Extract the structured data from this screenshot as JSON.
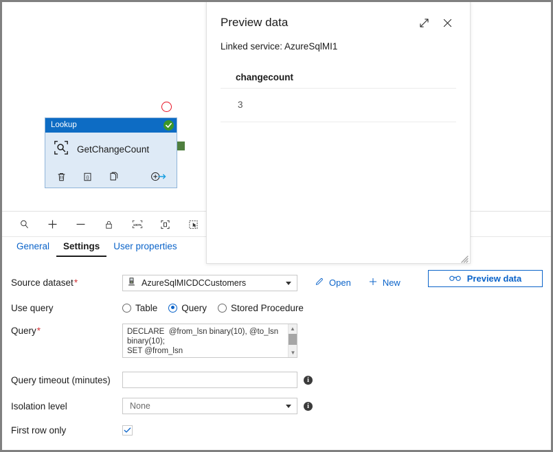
{
  "canvas": {
    "node": {
      "type_label": "Lookup",
      "name": "GetChangeCount",
      "status_icon": "check-icon",
      "actions": [
        "delete-icon",
        "code-icon",
        "clone-icon",
        "add-output-icon"
      ]
    },
    "toolbar": [
      {
        "name": "zoom-search-icon",
        "glyph": "search"
      },
      {
        "name": "zoom-in-icon",
        "glyph": "plus"
      },
      {
        "name": "zoom-out-icon",
        "glyph": "minus"
      },
      {
        "name": "lock-icon",
        "glyph": "lock"
      },
      {
        "name": "zoom-100-icon",
        "glyph": "100%"
      },
      {
        "name": "fit-to-screen-icon",
        "glyph": "fit"
      },
      {
        "name": "auto-align-icon",
        "glyph": "select"
      }
    ]
  },
  "tabs": [
    {
      "label": "General",
      "active": false
    },
    {
      "label": "Settings",
      "active": true
    },
    {
      "label": "User properties",
      "active": false
    }
  ],
  "form": {
    "source_dataset": {
      "label": "Source dataset",
      "required": "*",
      "value": "AzureSqlMICDCCustomers",
      "open_label": "Open",
      "new_label": "New",
      "preview_label": "Preview data"
    },
    "use_query": {
      "label": "Use query",
      "options": [
        {
          "label": "Table",
          "selected": false
        },
        {
          "label": "Query",
          "selected": true
        },
        {
          "label": "Stored Procedure",
          "selected": false
        }
      ]
    },
    "query": {
      "label": "Query",
      "required": "*",
      "value": "DECLARE  @from_lsn binary(10), @to_lsn\nbinary(10);\nSET @from_lsn"
    },
    "query_timeout": {
      "label": "Query timeout (minutes)",
      "value": "",
      "placeholder": ""
    },
    "isolation_level": {
      "label": "Isolation level",
      "value": "None"
    },
    "first_row_only": {
      "label": "First row only",
      "checked": true
    }
  },
  "preview_panel": {
    "title": "Preview data",
    "linked_service": "Linked service: AzureSqlMI1",
    "table": {
      "columns": [
        "changecount"
      ],
      "rows": [
        [
          "3"
        ]
      ]
    },
    "expand_icon": "expand-icon",
    "close_icon": "close-icon"
  },
  "colors": {
    "accent": "#0a63c9",
    "node_header": "#0d6cc4",
    "node_body": "#deeaf6",
    "success": "#3c9628",
    "failure": "#e81123",
    "success_connector": "#4f7f3f"
  }
}
